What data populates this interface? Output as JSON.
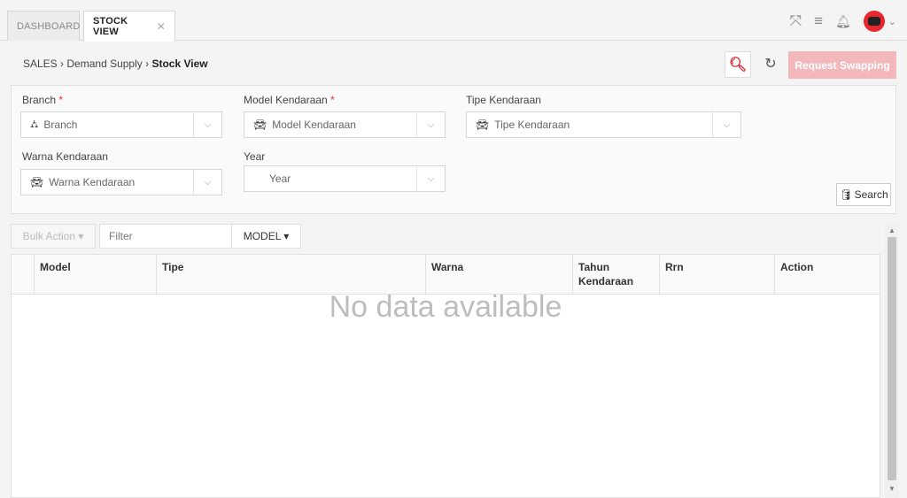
{
  "tabs": [
    {
      "label": "DASHBOARD"
    },
    {
      "label": "STOCK VIEW",
      "close": "✕"
    }
  ],
  "topbar": {
    "icons": [
      "expand-icon",
      "menu-icon",
      "bell-icon",
      "avatar"
    ],
    "expand_glyph": "⤧",
    "menu_glyph": "≡",
    "bell_glyph": "🔔︎",
    "caret": "⌄"
  },
  "breadcrumb": {
    "part1": "SALES",
    "sep": "›",
    "part2": "Demand Supply",
    "part3": "Stock View"
  },
  "actions": {
    "search_glyph": "🔍︎",
    "refresh_glyph": "↻",
    "request_label": "Request Swapping"
  },
  "filters": {
    "branch": {
      "label": "Branch",
      "required": "*",
      "placeholder": "Branch",
      "icon": "sitemap-icon"
    },
    "model": {
      "label": "Model Kendaraan",
      "required": "*",
      "placeholder": "Model Kendaraan",
      "icon": "car-icon"
    },
    "tipe": {
      "label": "Tipe Kendaraan",
      "placeholder": "Tipe Kendaraan",
      "icon": "car-icon"
    },
    "warna": {
      "label": "Warna Kendaraan",
      "placeholder": "Warna Kendaraan",
      "icon": "car-icon"
    },
    "year": {
      "label": "Year",
      "placeholder": "Year"
    },
    "search_label": "Search"
  },
  "table": {
    "bulk_action": "Bulk Action ▾",
    "filter_placeholder": "Filter",
    "model_button": "MODEL ▾",
    "columns": [
      "Model",
      "Tipe",
      "Warna",
      "Tahun Kendaraan",
      "Rrn",
      "Action"
    ],
    "empty": "No data available"
  },
  "colors": {
    "accent": "#d9262f",
    "request_button": "#f2b8bb"
  }
}
